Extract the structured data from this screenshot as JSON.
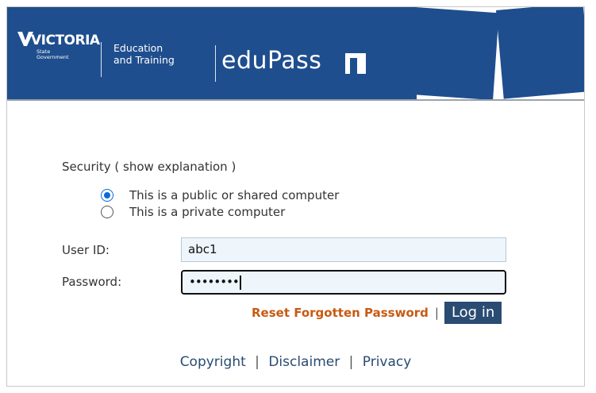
{
  "header": {
    "victoria_word": "VICTORIA",
    "victoria_sub": [
      "State",
      "Government"
    ],
    "dept_lines": [
      "Education",
      "and Training"
    ],
    "product_name": "eduPass"
  },
  "security": {
    "label": "Security (",
    "link": "show explanation",
    "close": ")",
    "options": [
      {
        "label": "This is a public or shared computer",
        "selected": true
      },
      {
        "label": "This is a private computer",
        "selected": false
      }
    ]
  },
  "form": {
    "user_id_label": "User ID:",
    "user_id_value": "abc1",
    "password_label": "Password:",
    "password_value": "••••••••"
  },
  "actions": {
    "reset_link": "Reset Forgotten Password",
    "separator": "|",
    "login_button": "Log in"
  },
  "footer": {
    "links": [
      "Copyright",
      "Disclaimer",
      "Privacy"
    ],
    "separator": "|"
  },
  "colors": {
    "brand_blue": "#1f4e8e",
    "link_orange": "#c85a12",
    "button_navy": "#2a4b72",
    "radio_blue": "#0a6ad8"
  },
  "icons": {
    "victoria_logo": "victoria-v-icon",
    "edupass_logo": "edupass-mark-icon"
  }
}
